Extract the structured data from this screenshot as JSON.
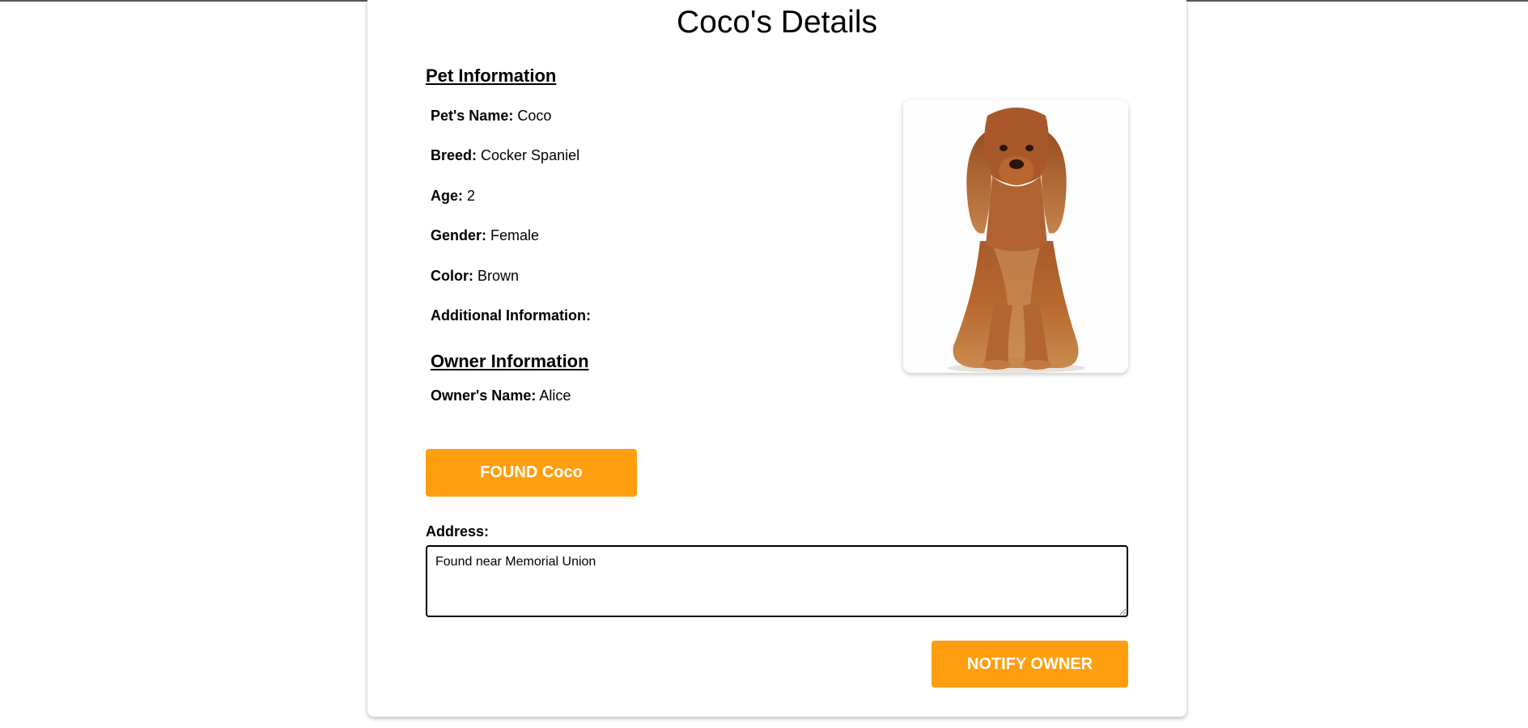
{
  "page": {
    "title": "Coco's Details"
  },
  "pet_info": {
    "heading": "Pet Information",
    "fields": [
      {
        "label": "Pet's Name:",
        "value": "Coco"
      },
      {
        "label": "Breed:",
        "value": "Cocker Spaniel"
      },
      {
        "label": "Age:",
        "value": "2"
      },
      {
        "label": "Gender:",
        "value": "Female"
      },
      {
        "label": "Color:",
        "value": "Brown"
      },
      {
        "label": "Additional Information:",
        "value": ""
      }
    ]
  },
  "owner_info": {
    "heading": "Owner Information",
    "fields": [
      {
        "label": "Owner's Name:",
        "value": "Alice"
      }
    ]
  },
  "photo": {
    "subject": "brown cocker spaniel sitting"
  },
  "actions": {
    "found_label": "FOUND Coco",
    "address_label": "Address:",
    "address_value": "Found near Memorial Union",
    "notify_label": "NOTIFY OWNER"
  },
  "colors": {
    "accent": "#ff9f0f",
    "text": "#000000",
    "background": "#ffffff"
  }
}
